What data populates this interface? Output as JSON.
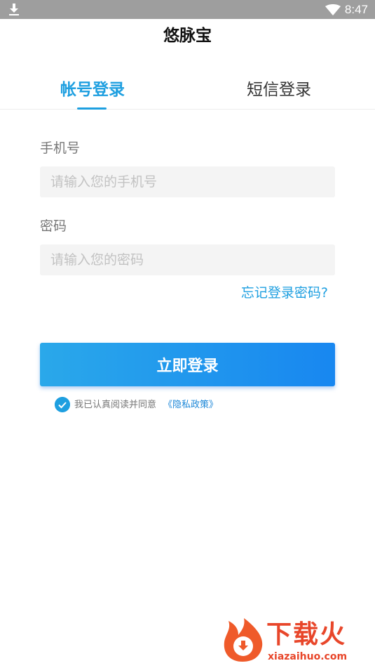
{
  "status_bar": {
    "time": "8:47"
  },
  "app": {
    "title": "悠脉宝"
  },
  "tabs": [
    {
      "label": "帐号登录",
      "active": true
    },
    {
      "label": "短信登录",
      "active": false
    }
  ],
  "form": {
    "phone_label": "手机号",
    "phone_placeholder": "请输入您的手机号",
    "phone_value": "",
    "password_label": "密码",
    "password_placeholder": "请输入您的密码",
    "password_value": "",
    "forgot_label": "忘记登录密码?",
    "login_label": "立即登录",
    "agree_text": "我已认真阅读并同意",
    "privacy_link": "《隐私政策》",
    "agree_checked": true
  },
  "watermark": {
    "text": "下载火",
    "url": "xiazaihuo.com"
  },
  "colors": {
    "accent": "#1e9fe0",
    "button_start": "#2aa8ea",
    "button_end": "#1887f0",
    "statusbar": "#9e9e9e"
  },
  "icons": [
    "download-icon",
    "wifi-icon",
    "check-circle-icon",
    "fire-logo-icon"
  ]
}
